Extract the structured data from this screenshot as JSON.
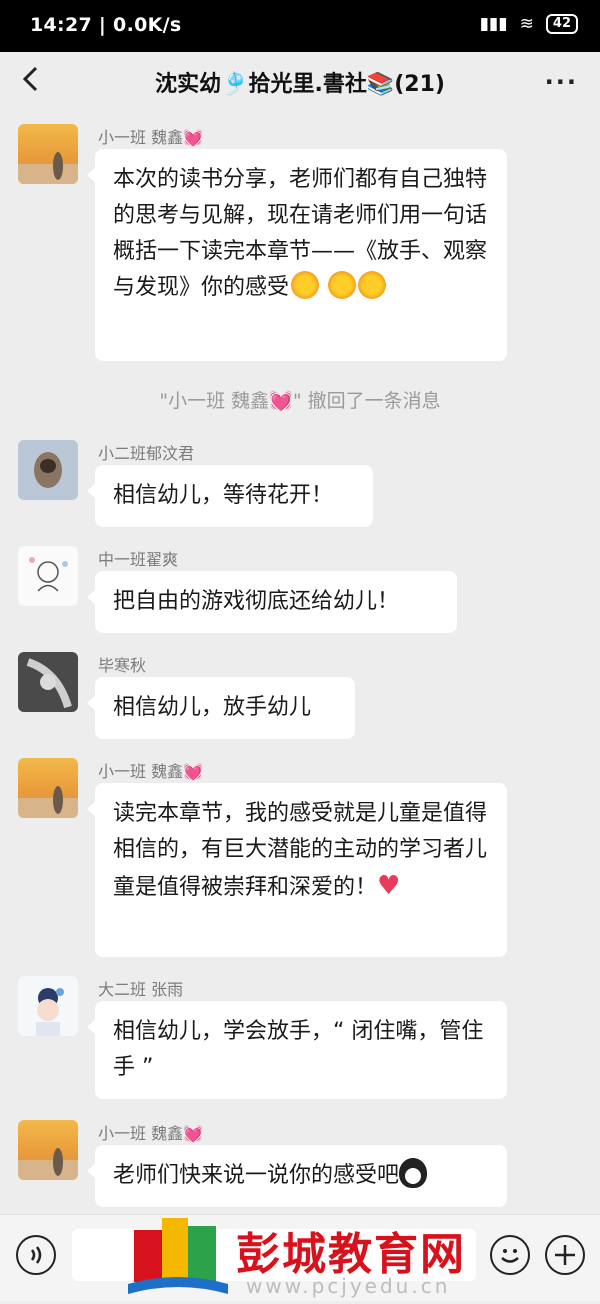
{
  "status": {
    "time_speed": "14:27 | 0.0K/s",
    "battery": "42"
  },
  "header": {
    "title": "沈实幼🎐拾光里.書社📚(21)",
    "more": "···"
  },
  "messages": [
    {
      "sender": "小一班 魏鑫💓",
      "text": "本次的读书分享，老师们都有自己独特的思考与见解，现在请老师们用一句话概括一下读完本章节——《放手、观察与发现》你的感受"
    },
    {
      "sender": "小二班郁汶君",
      "text": "相信幼儿，等待花开！"
    },
    {
      "sender": "中一班翟爽",
      "text": "把自由的游戏彻底还给幼儿！"
    },
    {
      "sender": "毕寒秋",
      "text": "相信幼儿，放手幼儿"
    },
    {
      "sender": "小一班 魏鑫💓",
      "text": "读完本章节，我的感受就是儿童是值得相信的，有巨大潜能的主动的学习者儿童是值得被崇拜和深爱的！"
    },
    {
      "sender": "大二班 张雨",
      "text": "相信幼儿，学会放手，“ 闭住嘴，管住手 ”"
    },
    {
      "sender": "小一班 魏鑫💓",
      "text": "老师们快来说一说你的感受吧"
    }
  ],
  "recall_notice": "\"小一班 魏鑫💓\" 撤回了一条消息",
  "watermark": {
    "text": "彭城教育网",
    "url": "www.pcjyedu.cn"
  },
  "colors": {
    "background": "#ededed",
    "bubble": "#ffffff",
    "watermark_red": "#d8121c"
  },
  "icons": [
    "back-icon",
    "more-icon",
    "voice-icon",
    "emoji-icon",
    "plus-icon",
    "sun-emoji",
    "heart-emoji",
    "penguin-emoji"
  ]
}
